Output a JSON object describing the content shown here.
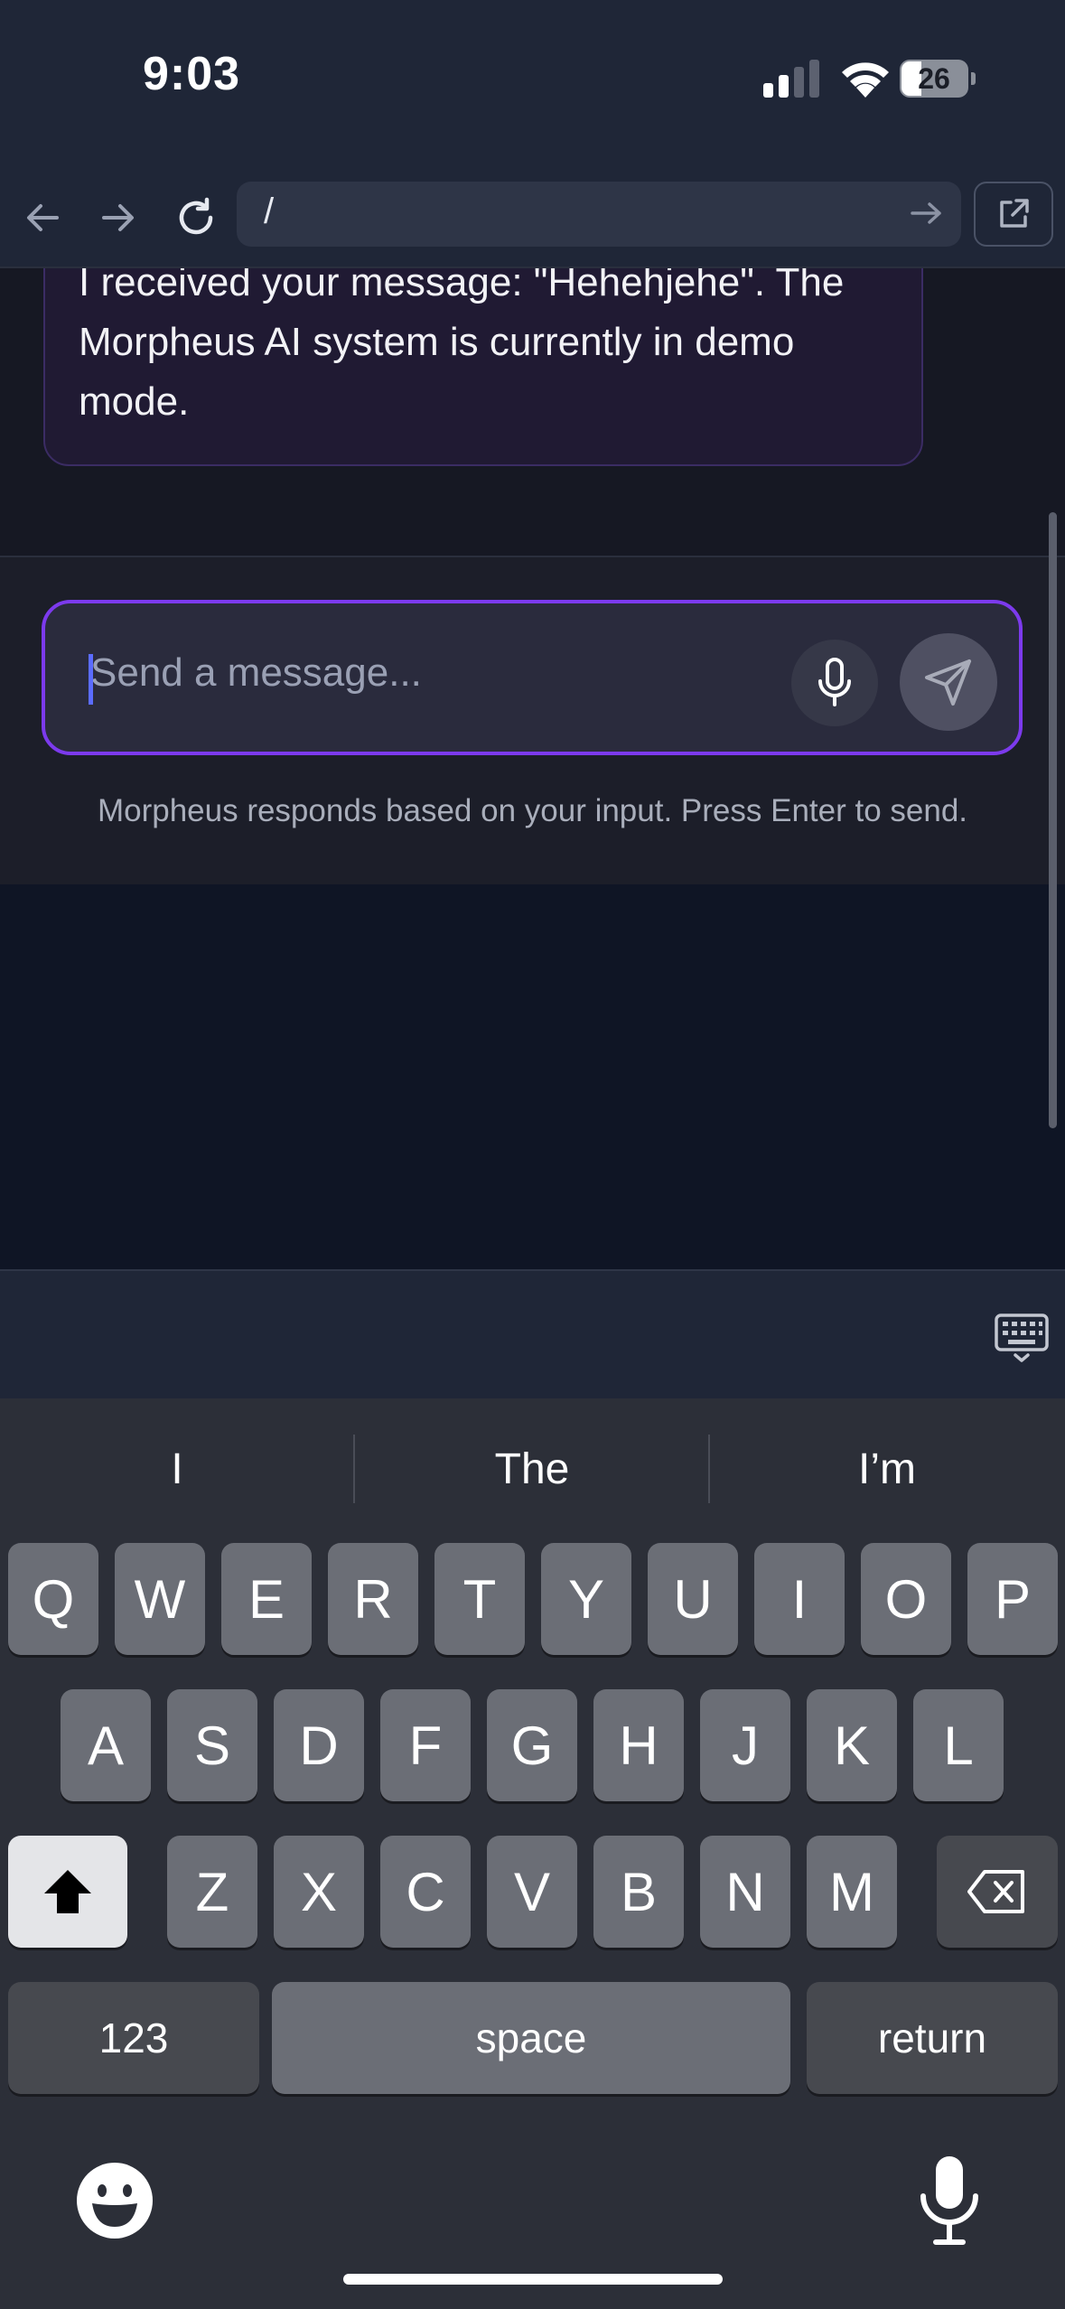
{
  "status": {
    "time": "9:03",
    "battery": "26"
  },
  "browser": {
    "url": "/"
  },
  "chat": {
    "message_lines": [
      "I received your message: \"Hehehjehe\". The",
      "Morpheus AI system is currently in demo",
      "mode."
    ]
  },
  "composer": {
    "placeholder": "Send a message...",
    "hint": "Morpheus responds based on your input. Press Enter to send."
  },
  "keyboard": {
    "suggestions": [
      "I",
      "The",
      "I’m"
    ],
    "row1": [
      "Q",
      "W",
      "E",
      "R",
      "T",
      "Y",
      "U",
      "I",
      "O",
      "P"
    ],
    "row2": [
      "A",
      "S",
      "D",
      "F",
      "G",
      "H",
      "J",
      "K",
      "L"
    ],
    "row3": [
      "Z",
      "X",
      "C",
      "V",
      "B",
      "N",
      "M"
    ],
    "numbers_label": "123",
    "space_label": "space",
    "return_label": "return"
  },
  "colors": {
    "accent": "#7c3aed",
    "bubble_border": "#3b2c64"
  },
  "icons": [
    "signal-icon",
    "wifi-icon",
    "battery-icon",
    "back-arrow-icon",
    "forward-arrow-icon",
    "reload-icon",
    "go-arrow-icon",
    "external-link-icon",
    "microphone-icon",
    "send-icon",
    "keyboard-icon",
    "shift-icon",
    "delete-icon",
    "emoji-icon",
    "dictation-icon"
  ]
}
